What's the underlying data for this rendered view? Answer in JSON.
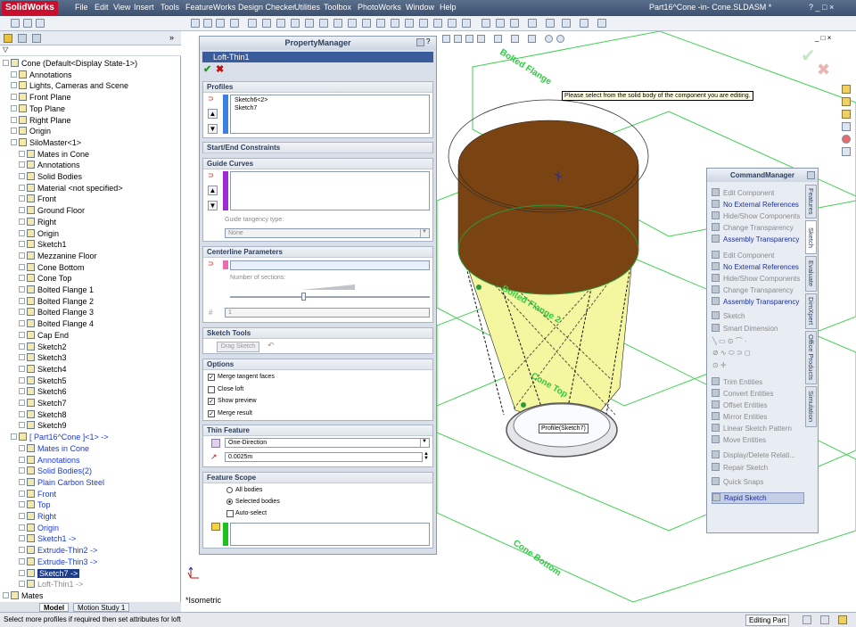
{
  "app": {
    "logo": "SolidWorks",
    "title": "Part16^Cone -in- Cone.SLDASM *"
  },
  "menu": [
    "File",
    "Edit",
    "View",
    "Insert",
    "Tools",
    "FeatureWorks",
    "Design Checker",
    "Utilities",
    "Toolbox",
    "PhotoWorks",
    "Window",
    "Help"
  ],
  "tree": [
    {
      "label": "Cone  (Default<Display State-1>)",
      "depth": 0,
      "color": "black"
    },
    {
      "label": "Annotations",
      "depth": 1,
      "color": "black"
    },
    {
      "label": "Lights, Cameras and Scene",
      "depth": 1,
      "color": "black"
    },
    {
      "label": "Front Plane",
      "depth": 1,
      "color": "black"
    },
    {
      "label": "Top Plane",
      "depth": 1,
      "color": "black"
    },
    {
      "label": "Right Plane",
      "depth": 1,
      "color": "black"
    },
    {
      "label": "Origin",
      "depth": 1,
      "color": "black"
    },
    {
      "label": "SiloMaster<1>",
      "depth": 1,
      "color": "black"
    },
    {
      "label": "Mates in Cone",
      "depth": 2,
      "color": "black"
    },
    {
      "label": "Annotations",
      "depth": 2,
      "color": "black"
    },
    {
      "label": "Solid Bodies",
      "depth": 2,
      "color": "black"
    },
    {
      "label": "Material <not specified>",
      "depth": 2,
      "color": "black"
    },
    {
      "label": "Front",
      "depth": 2,
      "color": "black"
    },
    {
      "label": "Ground Floor",
      "depth": 2,
      "color": "black"
    },
    {
      "label": "Right",
      "depth": 2,
      "color": "black"
    },
    {
      "label": "Origin",
      "depth": 2,
      "color": "black"
    },
    {
      "label": "Sketch1",
      "depth": 2,
      "color": "black"
    },
    {
      "label": "Mezzanine Floor",
      "depth": 2,
      "color": "black"
    },
    {
      "label": "Cone Bottom",
      "depth": 2,
      "color": "black"
    },
    {
      "label": "Cone Top",
      "depth": 2,
      "color": "black"
    },
    {
      "label": "Bolted Flange 1",
      "depth": 2,
      "color": "black"
    },
    {
      "label": "Bolted Flange 2",
      "depth": 2,
      "color": "black"
    },
    {
      "label": "Bolted Flange 3",
      "depth": 2,
      "color": "black"
    },
    {
      "label": "Bolted Flange 4",
      "depth": 2,
      "color": "black"
    },
    {
      "label": "Cap End",
      "depth": 2,
      "color": "black"
    },
    {
      "label": "Sketch2",
      "depth": 2,
      "color": "black"
    },
    {
      "label": "Sketch3",
      "depth": 2,
      "color": "black"
    },
    {
      "label": "Sketch4",
      "depth": 2,
      "color": "black"
    },
    {
      "label": "Sketch5",
      "depth": 2,
      "color": "black"
    },
    {
      "label": "Sketch6",
      "depth": 2,
      "color": "black"
    },
    {
      "label": "Sketch7",
      "depth": 2,
      "color": "black"
    },
    {
      "label": "Sketch8",
      "depth": 2,
      "color": "black"
    },
    {
      "label": "Sketch9",
      "depth": 2,
      "color": "black"
    },
    {
      "label": "[ Part16^Cone ]<1> ->",
      "depth": 1,
      "color": "blue"
    },
    {
      "label": "Mates in Cone",
      "depth": 2,
      "color": "blue"
    },
    {
      "label": "Annotations",
      "depth": 2,
      "color": "blue"
    },
    {
      "label": "Solid Bodies(2)",
      "depth": 2,
      "color": "blue"
    },
    {
      "label": "Plain Carbon Steel",
      "depth": 2,
      "color": "blue"
    },
    {
      "label": "Front",
      "depth": 2,
      "color": "blue"
    },
    {
      "label": "Top",
      "depth": 2,
      "color": "blue"
    },
    {
      "label": "Right",
      "depth": 2,
      "color": "blue"
    },
    {
      "label": "Origin",
      "depth": 2,
      "color": "blue"
    },
    {
      "label": "Sketch1 ->",
      "depth": 2,
      "color": "blue"
    },
    {
      "label": "Extrude-Thin2 ->",
      "depth": 2,
      "color": "blue"
    },
    {
      "label": "Extrude-Thin3 ->",
      "depth": 2,
      "color": "blue"
    },
    {
      "label": "Sketch7 ->",
      "depth": 2,
      "color": "selected"
    },
    {
      "label": "Loft-Thin1 ->",
      "depth": 2,
      "color": "grey"
    },
    {
      "label": "Mates",
      "depth": 0,
      "color": "black"
    }
  ],
  "pm": {
    "header": "PropertyManager",
    "feature": "Loft-Thin1",
    "profiles": {
      "title": "Profiles",
      "items": [
        "Sketch6<2>",
        "Sketch7"
      ]
    },
    "start_end": "Start/End Constraints",
    "guide": {
      "title": "Guide Curves",
      "tangency_label": "Guide tangency type:",
      "tangency_value": "None"
    },
    "centerline": {
      "title": "Centerline Parameters",
      "sections_label": "Number of sections:",
      "sections_value": "1"
    },
    "sketch_tools": {
      "title": "Sketch Tools",
      "drag_label": "Drag Sketch"
    },
    "options": {
      "title": "Options",
      "items": [
        {
          "label": "Merge tangent faces",
          "checked": true
        },
        {
          "label": "Close loft",
          "checked": false
        },
        {
          "label": "Show preview",
          "checked": true
        },
        {
          "label": "Merge result",
          "checked": true
        }
      ]
    },
    "thin": {
      "title": "Thin Feature",
      "direction": "One-Direction",
      "thickness": "0.0025m"
    },
    "scope": {
      "title": "Feature Scope",
      "all": "All bodies",
      "selected": "Selected bodies",
      "auto": "Auto-select"
    }
  },
  "viewport": {
    "tooltip": "Please select from the solid body of the component you are editing.",
    "profile_label": "Profile(Sketch7)",
    "plane_labels": [
      "Bolted Flange",
      "Bolted Flange 2",
      "Cone Top",
      "Cone Bottom"
    ],
    "view_name": "*Isometric"
  },
  "cmd": {
    "header": "CommandManager",
    "items": [
      {
        "label": "Edit Component",
        "enabled": false
      },
      {
        "label": "No External References",
        "enabled": true
      },
      {
        "label": "Hide/Show Components",
        "enabled": false
      },
      {
        "label": "Change Transparency",
        "enabled": false
      },
      {
        "label": "Assembly Transparency",
        "enabled": true
      },
      {
        "label": "Edit Component",
        "enabled": false
      },
      {
        "label": "No External References",
        "enabled": true
      },
      {
        "label": "Hide/Show Components",
        "enabled": false
      },
      {
        "label": "Change Transparency",
        "enabled": false
      },
      {
        "label": "Assembly Transparency",
        "enabled": true
      },
      {
        "label": "Sketch",
        "enabled": false
      },
      {
        "label": "Smart Dimension",
        "enabled": false
      },
      {
        "label": "Trim Entities",
        "enabled": false
      },
      {
        "label": "Convert Entities",
        "enabled": false
      },
      {
        "label": "Offset Entities",
        "enabled": false
      },
      {
        "label": "Mirror Entities",
        "enabled": false
      },
      {
        "label": "Linear Sketch Pattern",
        "enabled": false
      },
      {
        "label": "Move Entities",
        "enabled": false
      },
      {
        "label": "Display/Delete Relati...",
        "enabled": false
      },
      {
        "label": "Repair Sketch",
        "enabled": false
      },
      {
        "label": "Quick Snaps",
        "enabled": false
      },
      {
        "label": "Rapid Sketch",
        "enabled": true
      }
    ],
    "tabs": [
      "Features",
      "Sketch",
      "Evaluate",
      "DimXpert",
      "Office Products",
      "Simulation"
    ]
  },
  "bottom_tabs": [
    "Model",
    "Motion Study 1"
  ],
  "status": {
    "message": "Select more profiles if required then set attributes for loft",
    "mode": "Editing Part"
  },
  "colors": {
    "accent": "#3b5c9a",
    "plane": "#2ecc40",
    "preview": "#f4f6a0",
    "flange": "#7a4412"
  }
}
